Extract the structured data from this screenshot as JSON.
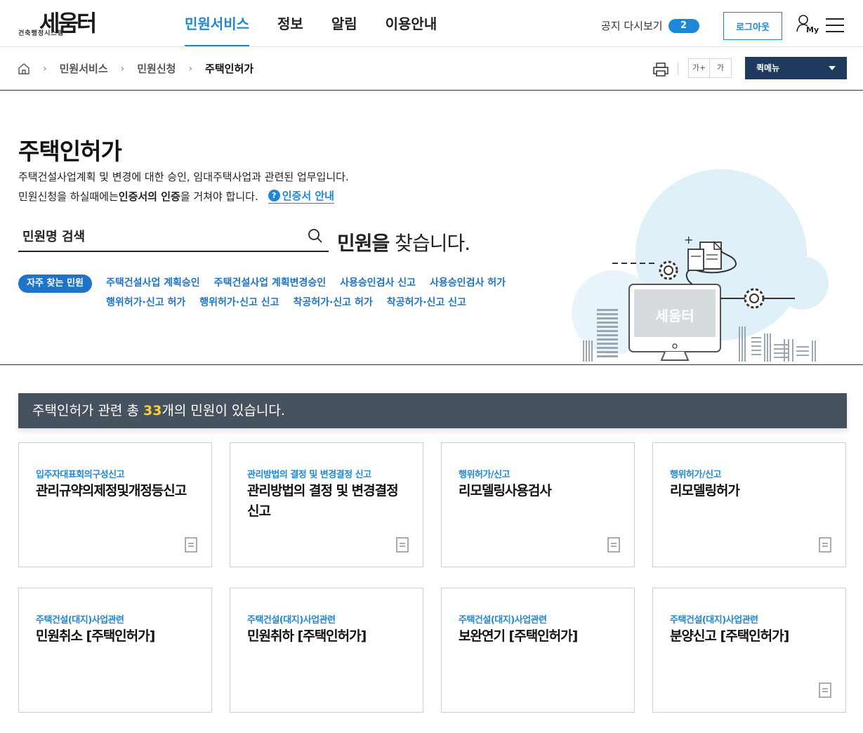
{
  "header": {
    "logo_main": "세움터",
    "logo_sub": "건축행정시스템",
    "nav": [
      {
        "label": "민원서비스",
        "active": true
      },
      {
        "label": "정보",
        "active": false
      },
      {
        "label": "알림",
        "active": false
      },
      {
        "label": "이용안내",
        "active": false
      }
    ],
    "notice_label": "공지 다시보기",
    "notice_count": "2",
    "logout_label": "로그아웃",
    "my_label": "My"
  },
  "breadcrumb": {
    "items": [
      "민원서비스",
      "민원신청",
      "주택인허가"
    ],
    "font_increase": "가+",
    "font_decrease": "가",
    "quickmenu_label": "퀵메뉴"
  },
  "hero": {
    "title": "주택인허가",
    "desc_line1": "주택건설사업계획 및 변경에 대한 승인, 임대주택사업과 관련된 업무입니다.",
    "desc_line2_a": "민원신청을 하실때에는 ",
    "desc_line2_b": "인증서의 인증",
    "desc_line2_c": "을 거쳐야 합니다.",
    "cert_link": "인증서 안내",
    "search_placeholder": "민원명 검색",
    "slogan_bold": "민원을",
    "slogan_rest": " 찾습니다.",
    "freq_label": "자주 찾는 민원",
    "freq_links": [
      "주택건설사업 계획승인",
      "주택건설사업 계획변경승인",
      "사용승인검사 신고",
      "사용승인검사 허가",
      "행위허가·신고 허가",
      "행위허가·신고 신고",
      "착공허가·신고 허가",
      "착공허가·신고 신고"
    ],
    "illustration_text": "세움터"
  },
  "result": {
    "prefix": "주택인허가 관련 총 ",
    "count": "33",
    "suffix": "개의 민원이 있습니다."
  },
  "cards": [
    {
      "category": "입주자대표회의구성신고",
      "title": "관리규약의제정및개정등신고",
      "doc_icon": true
    },
    {
      "category": "관리방법의 결정 및 변경결정 신고",
      "title": "관리방법의 결정 및 변경결정 신고",
      "doc_icon": true
    },
    {
      "category": "행위허가/신고",
      "title": "리모델링사용검사",
      "doc_icon": true
    },
    {
      "category": "행위허가/신고",
      "title": "리모델링허가",
      "doc_icon": true
    },
    {
      "category": "주택건설(대지)사업관련",
      "title": "민원취소 [주택인허가]",
      "doc_icon": false
    },
    {
      "category": "주택건설(대지)사업관련",
      "title": "민원취하 [주택인허가]",
      "doc_icon": false
    },
    {
      "category": "주택건설(대지)사업관련",
      "title": "보완연기 [주택인허가]",
      "doc_icon": false
    },
    {
      "category": "주택건설(대지)사업관련",
      "title": "분양신고 [주택인허가]",
      "doc_icon": true
    }
  ],
  "colors": {
    "accent": "#1e88d8",
    "result_bar": "#46525d",
    "count_highlight": "#f7d23a",
    "quickmenu_bg": "#1f3a5c"
  }
}
